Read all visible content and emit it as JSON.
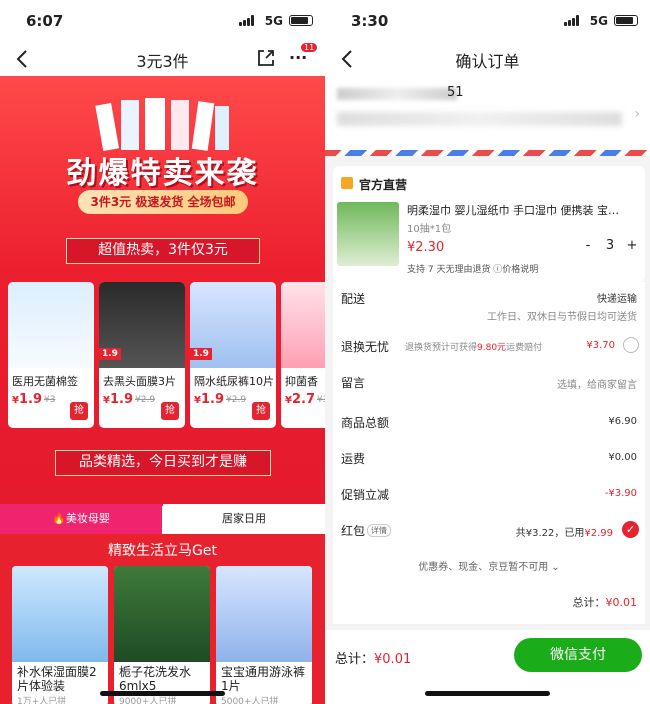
{
  "left": {
    "status": {
      "time": "6:07",
      "network": "5G"
    },
    "nav": {
      "title": "3元3件",
      "badge": "11"
    },
    "hero": {
      "slogan": "劲爆特卖来袭",
      "pill": "3件3元 极速发货 全场包邮",
      "banner1": "超值热卖，3件仅3元",
      "banner2": "品类精选，今日买到才是赚"
    },
    "products": [
      {
        "name": "医用无菌棉签",
        "price": "1.9",
        "old": "¥3",
        "grab": "抢"
      },
      {
        "name": "去黑头面膜3片",
        "price": "1.9",
        "old": "¥2.9",
        "grab": "抢"
      },
      {
        "name": "隔水纸尿裤10片",
        "price": "1.9",
        "old": "¥2.9",
        "grab": "抢"
      },
      {
        "name": "抑菌香",
        "price": "2.7",
        "old": "¥3",
        "grab": "抢"
      }
    ],
    "tabs": {
      "active": "美妆母婴",
      "inactive": "居家日用"
    },
    "section_title": "精致生活立马Get",
    "goods": [
      {
        "name": "补水保湿面膜2片体验装",
        "sold": "1万+人已拼"
      },
      {
        "name": "栀子花洗发水6mlx5",
        "sold": "9000+人已拼"
      },
      {
        "name": "宝宝通用游泳裤1片",
        "sold": "5000+人已拼"
      }
    ]
  },
  "right": {
    "status": {
      "time": "3:30",
      "network": "5G"
    },
    "nav": {
      "title": "确认订单"
    },
    "address_suffix": "51",
    "shop": {
      "name": "官方直营"
    },
    "goods": {
      "name": "明柔湿巾 婴儿湿纸巾 手口湿巾 便携装 宝…",
      "spec": "10抽*1包",
      "price": "¥2.30",
      "qty": "3",
      "minus": "-",
      "plus": "+",
      "support": "支持 7 天无理由退货 ⓘ价格说明"
    },
    "delivery": {
      "label": "配送",
      "value": "快递运输",
      "sub": "工作日、双休日与节假日均可送货"
    },
    "return": {
      "label": "退换无忧",
      "desc": "退换货预计可获得",
      "amount": "9.80元",
      "desc2": "运费赔付",
      "price": "¥3.70"
    },
    "message": {
      "label": "留言",
      "placeholder": "选填，给商家留言"
    },
    "summary": {
      "total_label": "商品总额",
      "total_value": "¥6.90",
      "shipping_label": "运费",
      "shipping_value": "¥0.00",
      "discount_label": "促销立减",
      "discount_value": "-¥3.90",
      "hongbao_label": "红包",
      "hongbao_tag": "详情",
      "hongbao_value": "共¥3.22，已用",
      "hongbao_used": "¥2.99",
      "coupons": "优惠券、现金、京豆暂不可用",
      "subtotal_label": "总计：",
      "subtotal_value": "¥0.01"
    },
    "footer": {
      "total_label": "总计：",
      "total_value": "¥0.01",
      "pay": "微信支付"
    }
  },
  "colors": {
    "red": "#e4242f",
    "pink": "#f0236e",
    "wechat": "#1aad19"
  }
}
